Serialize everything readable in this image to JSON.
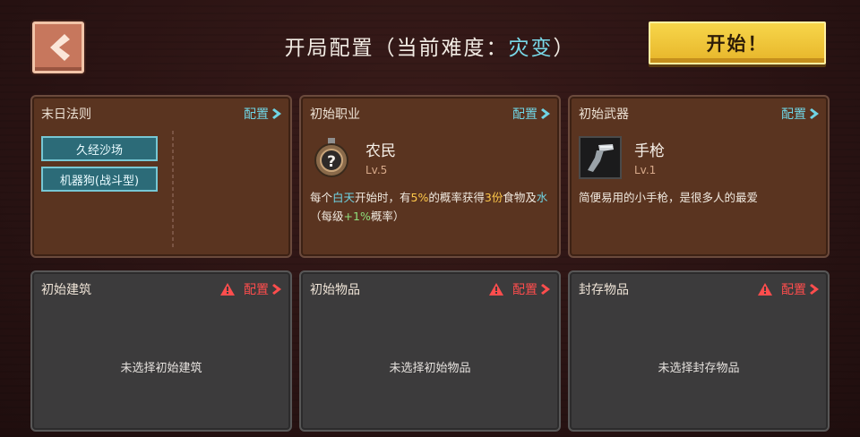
{
  "header": {
    "title_prefix": "开局配置（当前难度：",
    "difficulty": "灾变",
    "title_suffix": "）",
    "start_label": "开始！"
  },
  "colors": {
    "accent_cyan": "#6fd4e4",
    "accent_gold": "#ffc94a",
    "warning_red": "#ff4d4d",
    "start_yellow": "#f1c93a"
  },
  "panels": {
    "rules": {
      "title": "末日法则",
      "config_label": "配置",
      "tags": [
        "久经沙场",
        "机器狗(战斗型)"
      ]
    },
    "profession": {
      "title": "初始职业",
      "config_label": "配置",
      "name": "农民",
      "level": "Lv.5",
      "icon": "question-badge-icon",
      "desc": {
        "p1": "每个",
        "h1": "白天",
        "p2": "开始时，有",
        "h2": "5%",
        "p3": "的概率获得",
        "h3": "3份",
        "p4": "食物及",
        "h4": "水",
        "p5": "（每级",
        "h5": "+1%",
        "p6": "概率）"
      }
    },
    "weapon": {
      "title": "初始武器",
      "config_label": "配置",
      "name": "手枪",
      "level": "Lv.1",
      "icon": "pistol-icon",
      "desc": "简便易用的小手枪，是很多人的最爱"
    },
    "building": {
      "title": "初始建筑",
      "config_label": "配置",
      "empty": "未选择初始建筑"
    },
    "items": {
      "title": "初始物品",
      "config_label": "配置",
      "empty": "未选择初始物品"
    },
    "storage": {
      "title": "封存物品",
      "config_label": "配置",
      "empty": "未选择封存物品"
    }
  }
}
